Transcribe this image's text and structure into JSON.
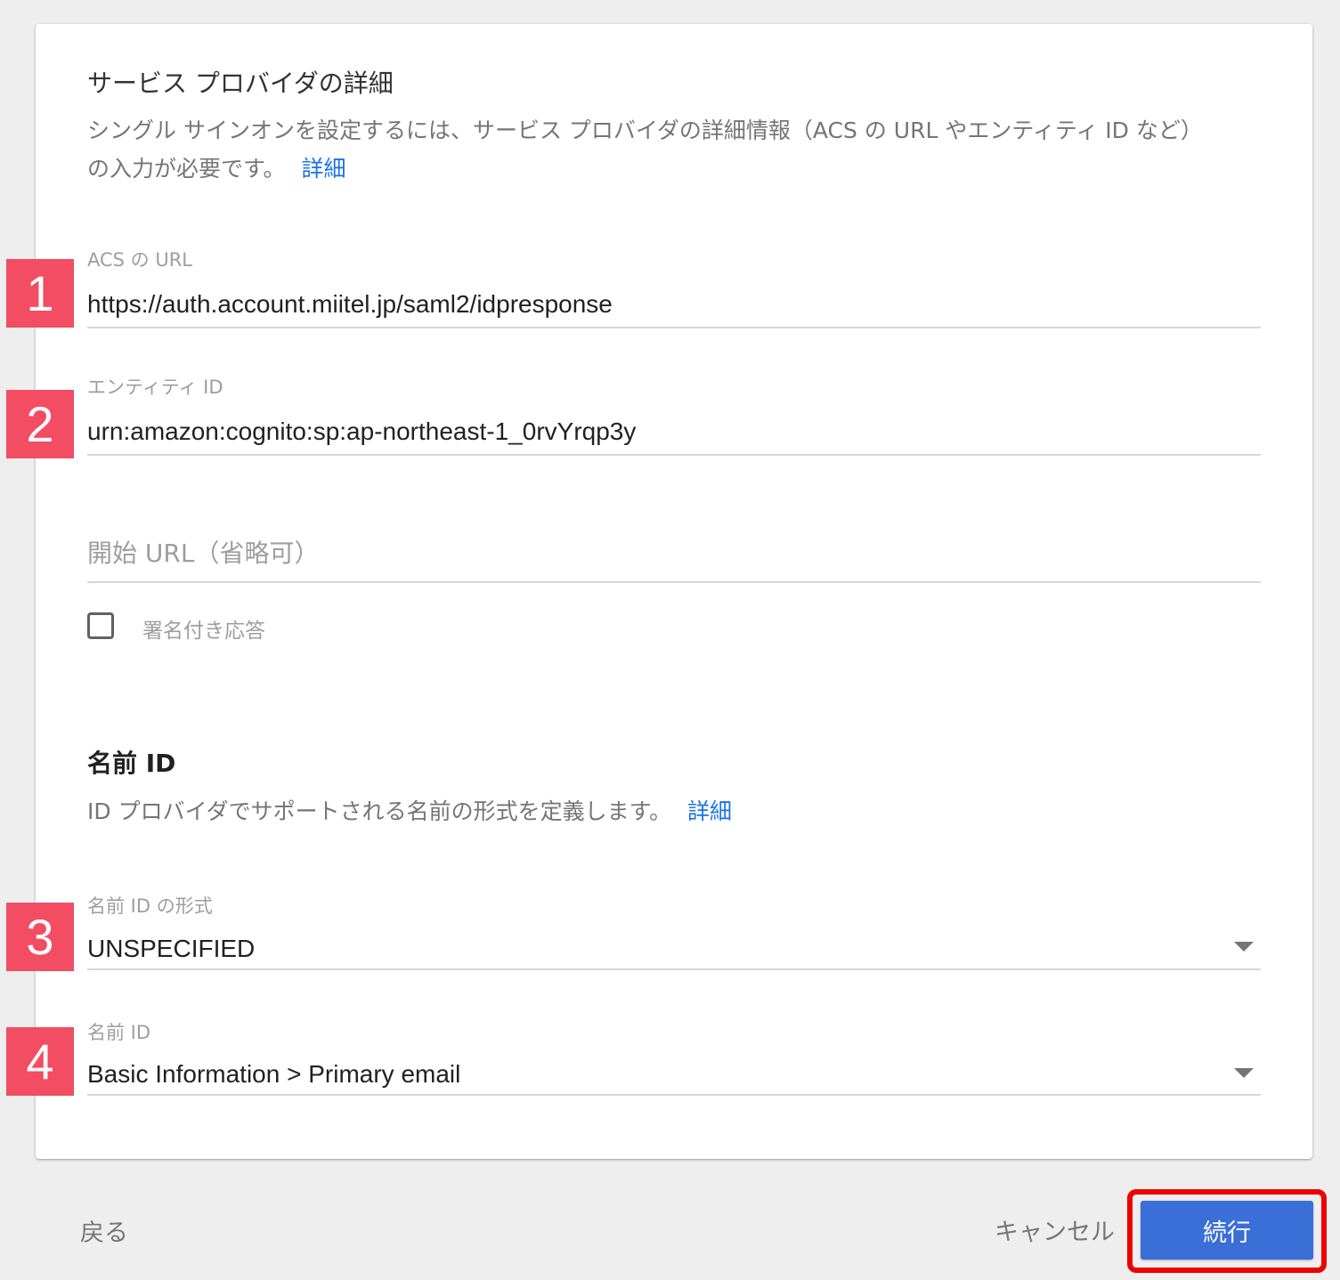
{
  "sp_details": {
    "title": "サービス プロバイダの詳細",
    "description_line1": "シングル サインオンを設定するには、サービス プロバイダの詳細情報（ACS の URL やエンティティ ID など）",
    "description_line2": "の入力が必要です。",
    "learn_more": "詳細"
  },
  "acs_url": {
    "label": "ACS の URL",
    "value": "https://auth.account.miitel.jp/saml2/idpresponse"
  },
  "entity_id": {
    "label": "エンティティ ID",
    "value": "urn:amazon:cognito:sp:ap-northeast-1_0rvYrqp3y"
  },
  "start_url": {
    "placeholder": "開始 URL（省略可）",
    "value": ""
  },
  "signed_response": {
    "label": "署名付き応答",
    "checked": false
  },
  "name_id_section": {
    "title": "名前 ID",
    "description": "ID プロバイダでサポートされる名前の形式を定義します。",
    "learn_more": "詳細"
  },
  "name_id_format": {
    "label": "名前 ID の形式",
    "value": "UNSPECIFIED"
  },
  "name_id": {
    "label": "名前 ID",
    "value": "Basic Information > Primary email"
  },
  "badges": [
    "1",
    "2",
    "3",
    "4"
  ],
  "footer": {
    "back": "戻る",
    "cancel": "キャンセル",
    "continue": "続行"
  },
  "colors": {
    "link": "#1a73e8",
    "primary_button": "#3a6fd8",
    "badge": "#f24d63",
    "highlight": "#ee0000"
  }
}
